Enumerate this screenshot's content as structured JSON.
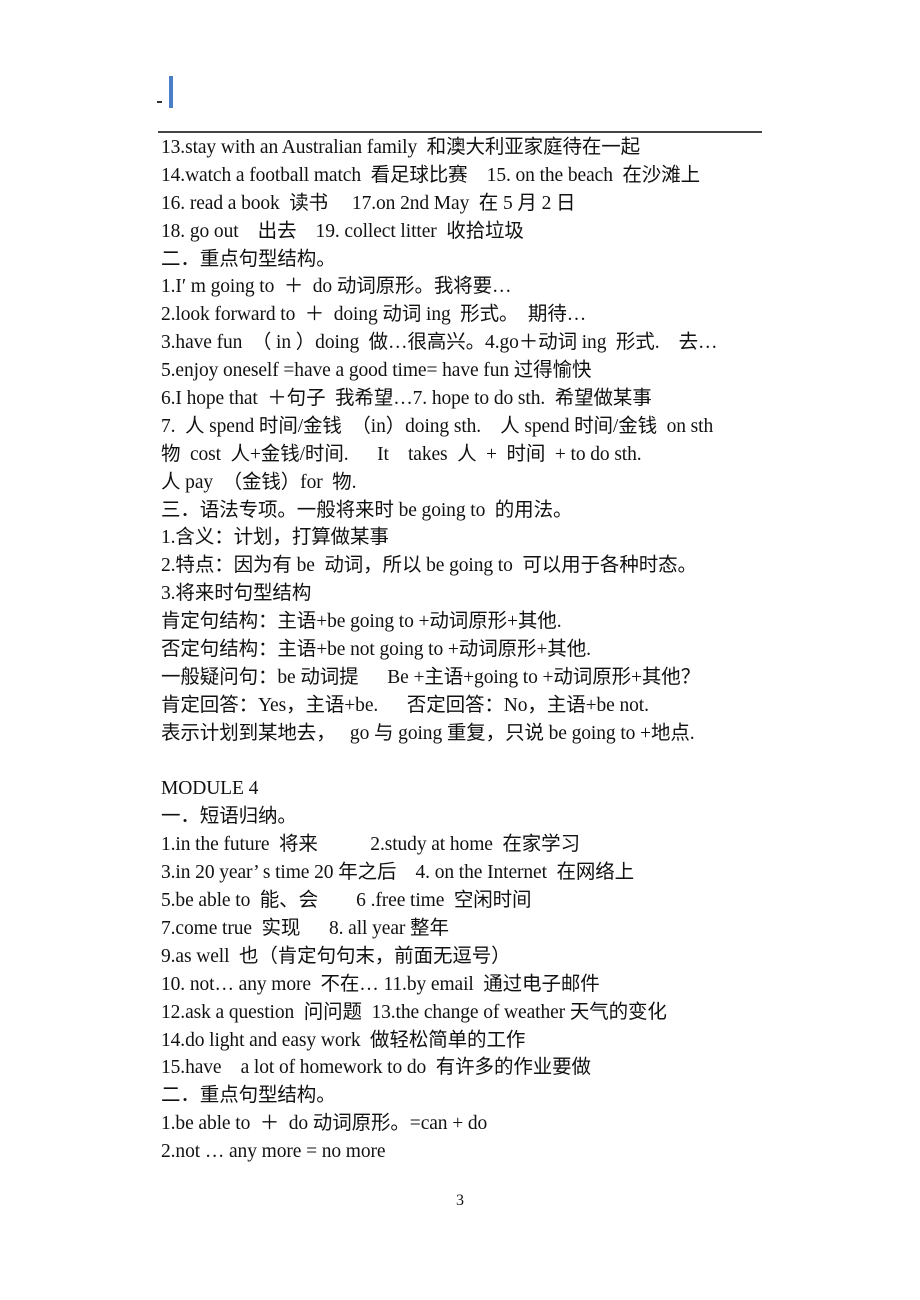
{
  "document": {
    "header": {
      "marker_text": "-"
    },
    "lines": [
      "13.stay with an Australian family  和澳大利亚家庭待在一起",
      "14.watch a football match  看足球比赛    15. on the beach  在沙滩上",
      "16. read a book  读书     17.on 2nd May  在 5 月 2 日",
      "18. go out    出去    19. collect litter  收拾垃圾",
      "二．重点句型结构。",
      "1.I′ m going to  ＋  do 动词原形。我将要…",
      "2.look forward to  ＋  doing 动词 ing  形式。  期待…",
      "3.have fun  （ in ）doing  做…很高兴。4.go＋动词 ing  形式.    去…",
      "5.enjoy oneself =have a good time= have fun 过得愉快",
      "6.I hope that  ＋句子  我希望…7. hope to do sth.  希望做某事",
      "7.  人 spend 时间/金钱  （in）doing sth.    人 spend 时间/金钱  on sth",
      "物  cost  人+金钱/时间.      It    takes  人  +  时间  + to do sth.",
      "人 pay  （金钱）for  物.",
      "三．语法专项。一般将来时 be going to  的用法。",
      "1.含义：计划，打算做某事",
      "2.特点：因为有 be  动词，所以 be going to  可以用于各种时态。",
      "3.将来时句型结构",
      "肯定句结构：主语+be going to +动词原形+其他.",
      "否定句结构：主语+be not going to +动词原形+其他.",
      "一般疑问句：be 动词提      Be +主语+going to +动词原形+其他？",
      "肯定回答：Yes，主语+be.      否定回答：No，主语+be not.",
      "表示计划到某地去，   go 与 going 重复，只说 be going to +地点.",
      "",
      "MODULE 4",
      "一．短语归纳。",
      "1.in the future  将来           2.study at home  在家学习",
      "3.in 20 year’ s time 20 年之后    4. on the Internet  在网络上",
      "5.be able to  能、会        6 .free time  空闲时间",
      "7.come true  实现      8. all year 整年",
      "9.as well  也（肯定句句末，前面无逗号）",
      "10. not… any more  不在… 11.by email  通过电子邮件",
      "12.ask a question  问问题  13.the change of weather 天气的变化",
      "14.do light and easy work  做轻松简单的工作",
      "15.have    a lot of homework to do  有许多的作业要做",
      "二．重点句型结构。",
      "1.be able to  ＋  do 动词原形。=can + do",
      "2.not … any more = no more"
    ],
    "page_number": "3"
  }
}
